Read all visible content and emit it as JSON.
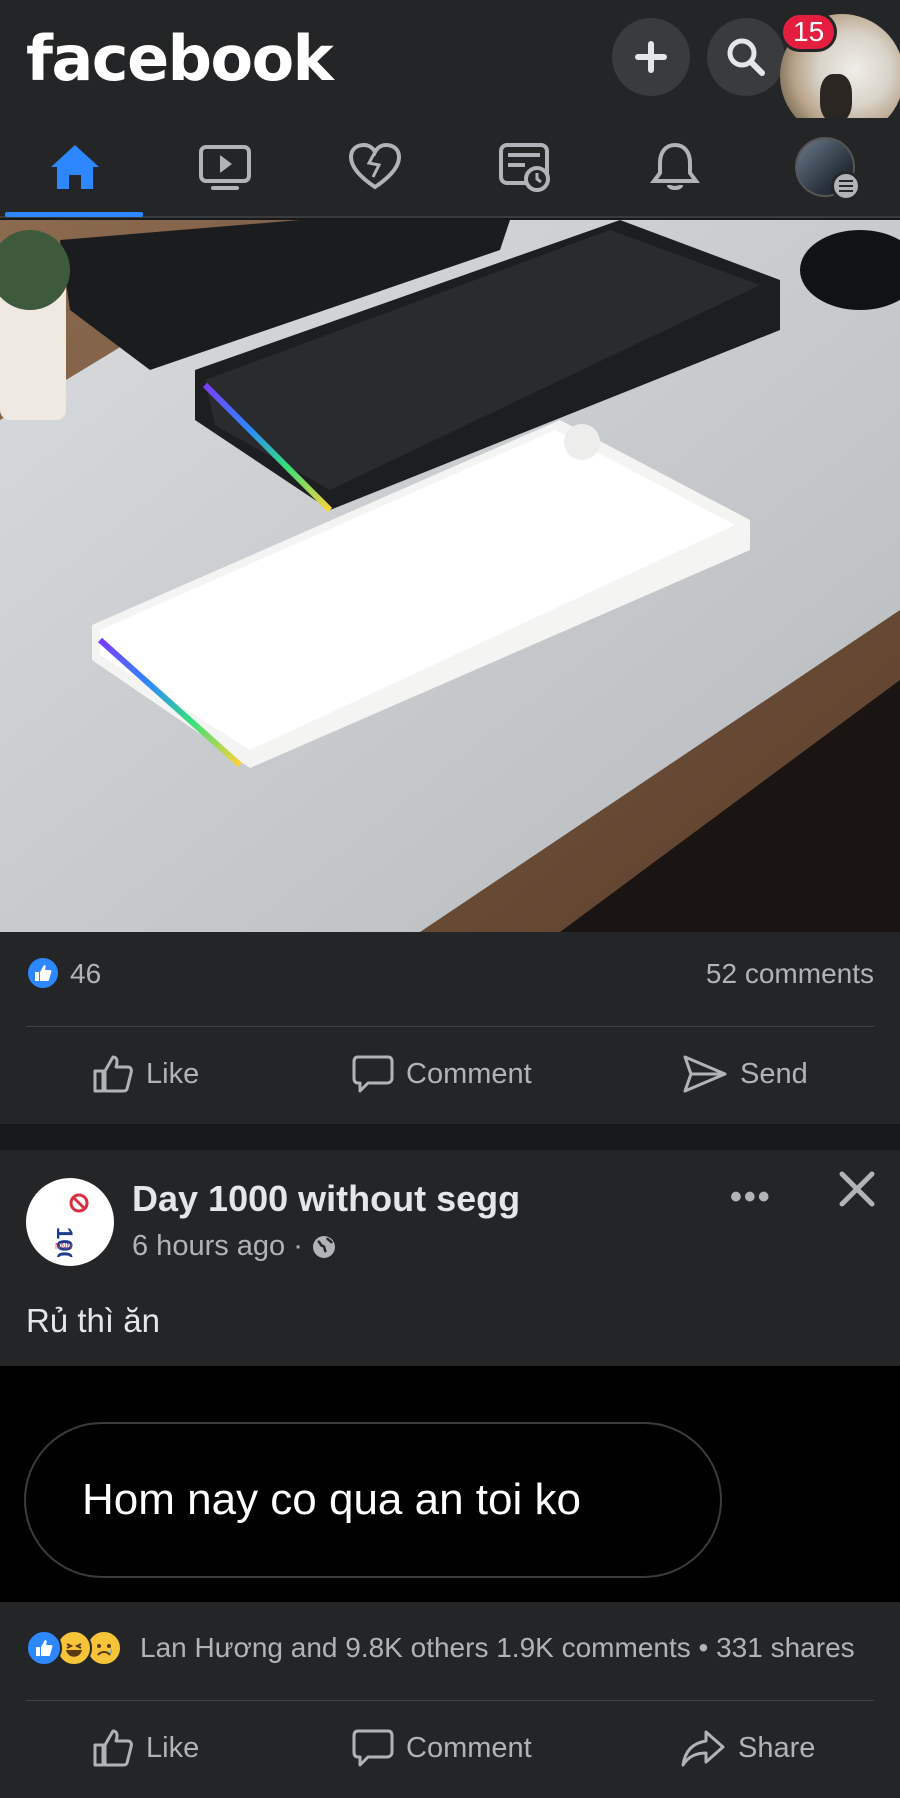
{
  "header": {
    "logo": "facebook",
    "notification_count": "15",
    "icons": [
      "add-icon",
      "search-icon"
    ]
  },
  "nav": {
    "tabs": [
      "home-icon",
      "video-icon",
      "dating-icon",
      "marketplace-icon",
      "notifications-icon",
      "menu-icon"
    ],
    "active": "home"
  },
  "post1": {
    "like_count": "46",
    "comments": "52 comments",
    "actions": {
      "like": "Like",
      "comment": "Comment",
      "send": "Send"
    }
  },
  "post2": {
    "author": "Day 1000 without segg",
    "time": "6 hours ago ·",
    "text": "Rủ thì ăn",
    "bubble_text": "Hom nay co qua an toi ko",
    "reactions_summary": "Lan Hương and 9.8K others  1.9K comments • 331 shares",
    "actions": {
      "like": "Like",
      "comment": "Comment",
      "share": "Share"
    }
  },
  "colors": {
    "accent": "#2d88ff",
    "badge": "#e41e3f",
    "background": "#242526"
  }
}
